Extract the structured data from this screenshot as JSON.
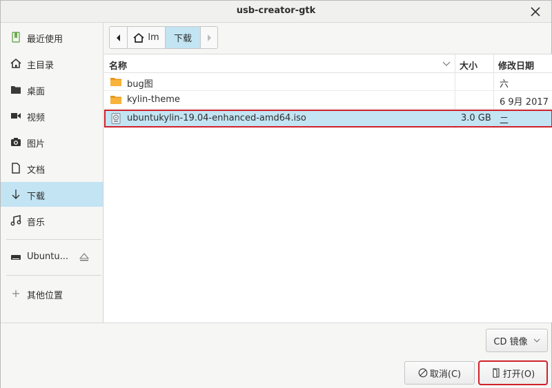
{
  "window": {
    "title": "usb-creator-gtk"
  },
  "sidebar": {
    "items": [
      {
        "label": "最近使用",
        "icon": "recent-icon"
      },
      {
        "label": "主目录",
        "icon": "home-icon"
      },
      {
        "label": "桌面",
        "icon": "folder-icon"
      },
      {
        "label": "视频",
        "icon": "video-icon"
      },
      {
        "label": "图片",
        "icon": "camera-icon"
      },
      {
        "label": "文档",
        "icon": "document-icon"
      },
      {
        "label": "下载",
        "icon": "download-icon"
      },
      {
        "label": "音乐",
        "icon": "music-icon"
      }
    ],
    "device": {
      "label": "Ubuntu...",
      "icon": "drive-icon",
      "eject_icon": "eject-icon"
    },
    "other": {
      "label": "其他位置",
      "icon": "plus-icon"
    }
  },
  "pathbar": {
    "home_label": "lm",
    "current_label": "下载"
  },
  "filelist": {
    "columns": {
      "name": "名称",
      "size": "大小",
      "modified": "修改日期"
    },
    "rows": [
      {
        "name": "bug图",
        "size": "",
        "modified": "六",
        "icon": "folder-icon"
      },
      {
        "name": "kylin-theme",
        "size": "",
        "modified": "6 9月 2017",
        "icon": "folder-icon"
      },
      {
        "name": "ubuntukylin-19.04-enhanced-amd64.iso",
        "size": "3.0 GB",
        "modified": "二",
        "icon": "disc-image-icon",
        "selected": true
      }
    ]
  },
  "filter": {
    "selected": "CD 镜像"
  },
  "buttons": {
    "cancel": "取消(C)",
    "open": "打开(O)"
  },
  "colors": {
    "selection": "#c2e4f3",
    "highlight_border": "#d0202a",
    "folder": "#f5a623"
  }
}
